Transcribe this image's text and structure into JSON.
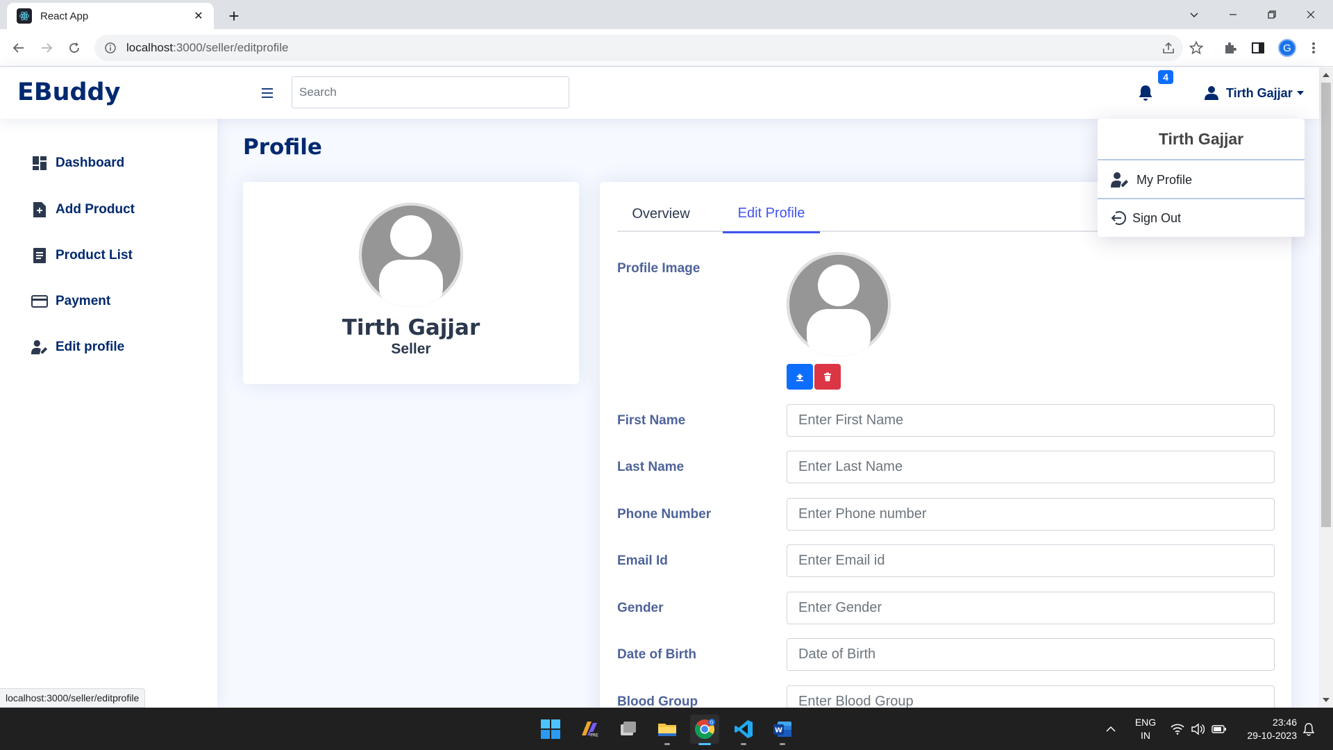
{
  "browser": {
    "tab_title": "React App",
    "url_host": "localhost",
    "url_path": ":3000/seller/editprofile",
    "profile_initial": "G",
    "status_url": "localhost:3000/seller/editprofile"
  },
  "header": {
    "logo": "EBuddy",
    "search_placeholder": "Search",
    "notification_count": "4",
    "user_name": "Tirth Gajjar"
  },
  "sidebar": {
    "items": [
      {
        "label": "Dashboard",
        "icon": "dashboard-icon"
      },
      {
        "label": "Add Product",
        "icon": "file-plus-icon"
      },
      {
        "label": "Product List",
        "icon": "list-doc-icon"
      },
      {
        "label": "Payment",
        "icon": "credit-card-icon"
      },
      {
        "label": "Edit profile",
        "icon": "user-edit-icon"
      }
    ]
  },
  "page": {
    "title": "Profile"
  },
  "profile_card": {
    "name": "Tirth Gajjar",
    "role": "Seller"
  },
  "tabs": {
    "overview": "Overview",
    "edit_profile": "Edit Profile",
    "active": "edit_profile"
  },
  "form": {
    "profile_image_label": "Profile Image",
    "fields": [
      {
        "label": "First Name",
        "placeholder": "Enter First Name"
      },
      {
        "label": "Last Name",
        "placeholder": "Enter Last Name"
      },
      {
        "label": "Phone Number",
        "placeholder": "Enter Phone number"
      },
      {
        "label": "Email Id",
        "placeholder": "Enter Email id"
      },
      {
        "label": "Gender",
        "placeholder": "Enter Gender"
      },
      {
        "label": "Date of Birth",
        "placeholder": "Date of Birth"
      },
      {
        "label": "Blood Group",
        "placeholder": "Enter Blood Group"
      }
    ]
  },
  "dropdown": {
    "header": "Tirth Gajjar",
    "my_profile": "My Profile",
    "sign_out": "Sign Out"
  },
  "taskbar": {
    "lang_line1": "ENG",
    "lang_line2": "IN",
    "time": "23:46",
    "date": "29-10-2023"
  },
  "colors": {
    "brand": "#012970",
    "accent": "#4154f1",
    "label": "#4e6399",
    "primary_button": "#0d6efd",
    "danger_button": "#dc3545"
  }
}
